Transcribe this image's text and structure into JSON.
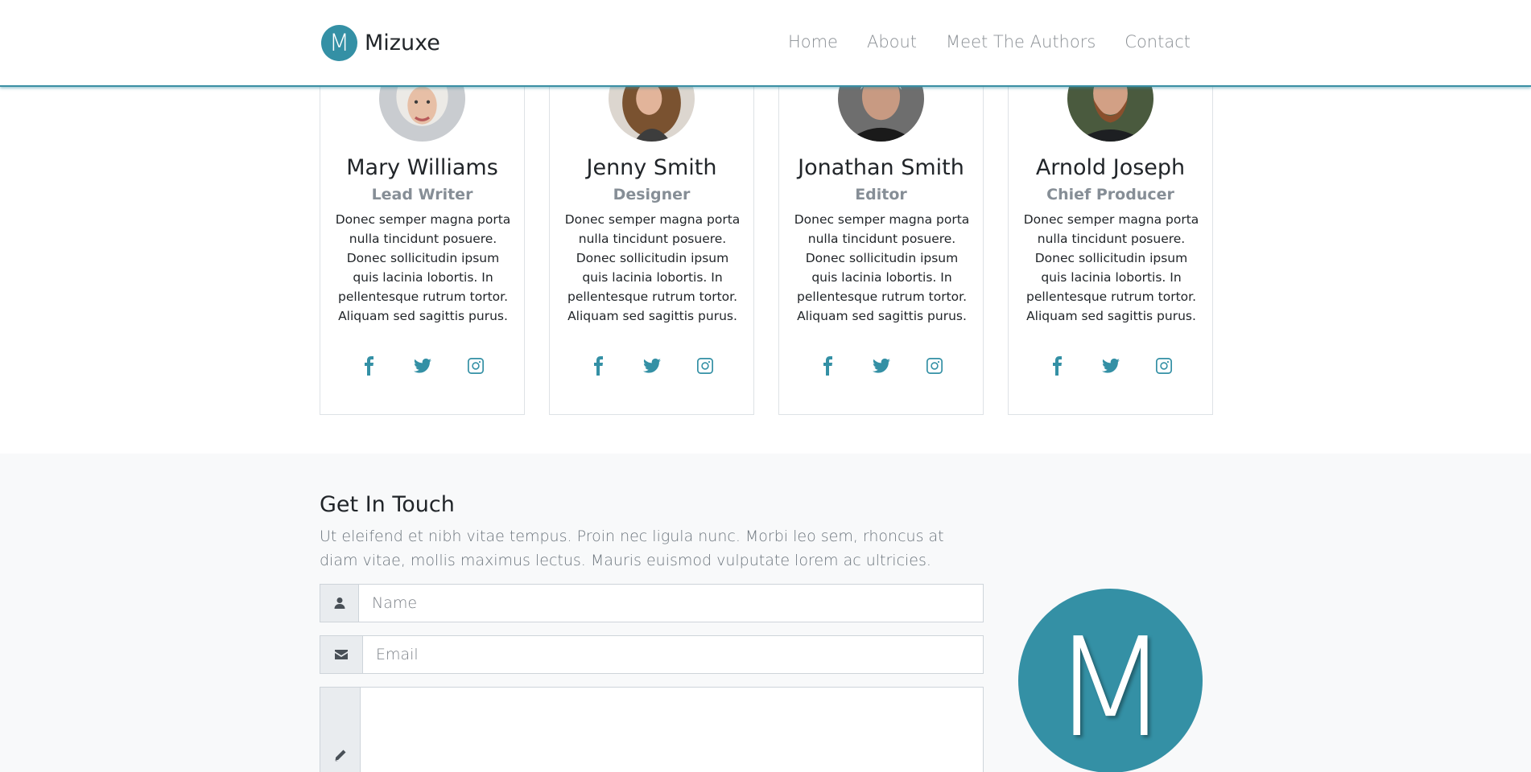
{
  "navbar": {
    "logo_letter": "M",
    "brand_name": "Mizuxe",
    "links": [
      "Home",
      "About",
      "Meet The Authors",
      "Contact"
    ]
  },
  "authors": [
    {
      "name": "Mary Williams",
      "role": "Lead Writer",
      "bio": "Donec semper magna porta nulla tincidunt posuere. Donec sollicitudin ipsum quis lacinia lobortis. In pellentesque rutrum tortor. Aliquam sed sagittis purus."
    },
    {
      "name": "Jenny Smith",
      "role": "Designer",
      "bio": "Donec semper magna porta nulla tincidunt posuere. Donec sollicitudin ipsum quis lacinia lobortis. In pellentesque rutrum tortor. Aliquam sed sagittis purus."
    },
    {
      "name": "Jonathan Smith",
      "role": "Editor",
      "bio": "Donec semper magna porta nulla tincidunt posuere. Donec sollicitudin ipsum quis lacinia lobortis. In pellentesque rutrum tortor. Aliquam sed sagittis purus."
    },
    {
      "name": "Arnold Joseph",
      "role": "Chief Producer",
      "bio": "Donec semper magna porta nulla tincidunt posuere. Donec sollicitudin ipsum quis lacinia lobortis. In pellentesque rutrum tortor. Aliquam sed sagittis purus."
    }
  ],
  "social_icons": [
    "facebook-icon",
    "twitter-icon",
    "instagram-icon"
  ],
  "contact": {
    "title": "Get In Touch",
    "text": "Ut eleifend et nibh vitae tempus. Proin nec ligula nunc. Morbi leo sem, rhoncus at diam vitae, mollis maximus lectus. Mauris euismod vulputate lorem ac ultricies.",
    "name_placeholder": "Name",
    "email_placeholder": "Email",
    "message_value": "",
    "logo_letter": "M"
  },
  "colors": {
    "accent": "#3490a5",
    "muted_text": "#868e96",
    "section_bg": "#f8f9fa"
  }
}
